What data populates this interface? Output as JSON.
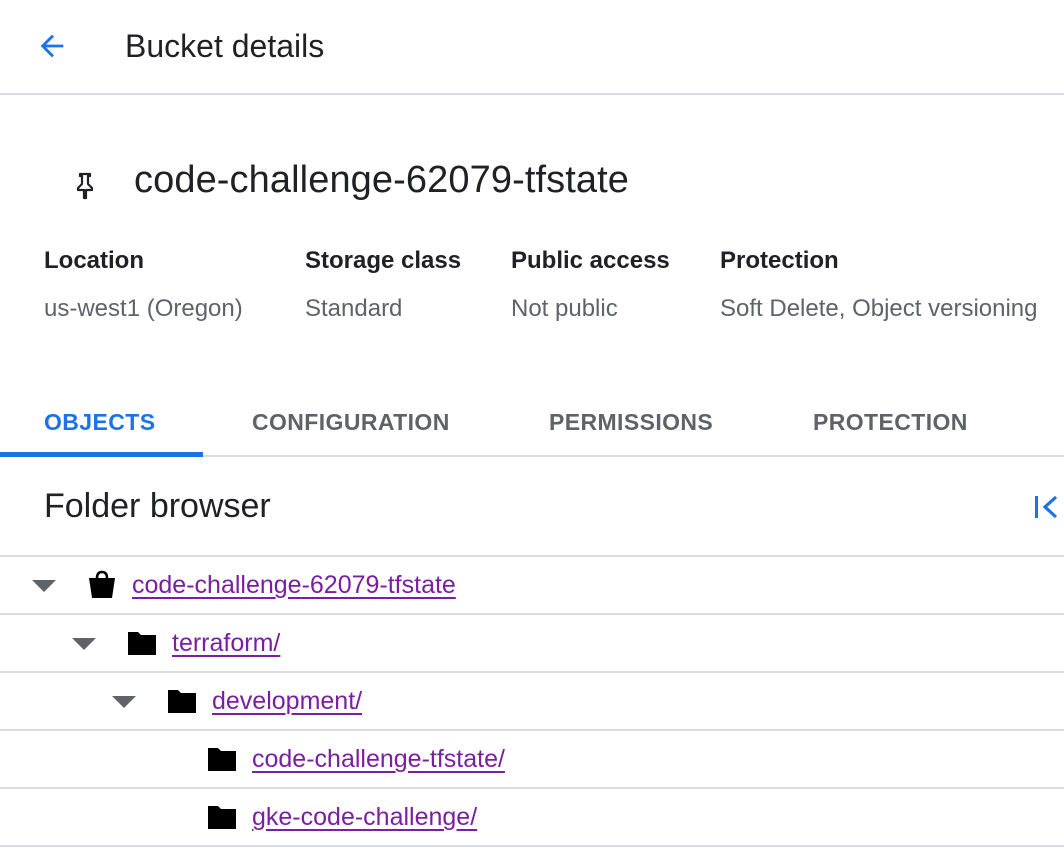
{
  "header": {
    "title": "Bucket details",
    "back_icon": "arrow-back-icon",
    "accent_color": "#1a73e8"
  },
  "bucket": {
    "name": "code-challenge-62079-tfstate",
    "pin_icon": "pin-icon"
  },
  "summary": [
    {
      "label": "Location",
      "value": "us-west1 (Oregon)"
    },
    {
      "label": "Storage class",
      "value": "Standard"
    },
    {
      "label": "Public access",
      "value": "Not public"
    },
    {
      "label": "Protection",
      "value": "Soft Delete, Object versioning"
    }
  ],
  "tabs": [
    {
      "label": "OBJECTS",
      "active": true
    },
    {
      "label": "CONFIGURATION",
      "active": false
    },
    {
      "label": "PERMISSIONS",
      "active": false
    },
    {
      "label": "PROTECTION",
      "active": false
    }
  ],
  "folder_browser": {
    "title": "Folder browser",
    "collapse_icon": "collapse-panel-icon",
    "link_color": "#7b1fa2",
    "items": [
      {
        "name": "code-challenge-62079-tfstate",
        "type": "bucket",
        "expanded": true,
        "depth": 0
      },
      {
        "name": "terraform/",
        "type": "folder",
        "expanded": true,
        "depth": 1
      },
      {
        "name": "development/",
        "type": "folder",
        "expanded": true,
        "depth": 2
      },
      {
        "name": "code-challenge-tfstate/",
        "type": "folder",
        "expanded": false,
        "depth": 3
      },
      {
        "name": "gke-code-challenge/",
        "type": "folder",
        "expanded": false,
        "depth": 3
      }
    ]
  }
}
